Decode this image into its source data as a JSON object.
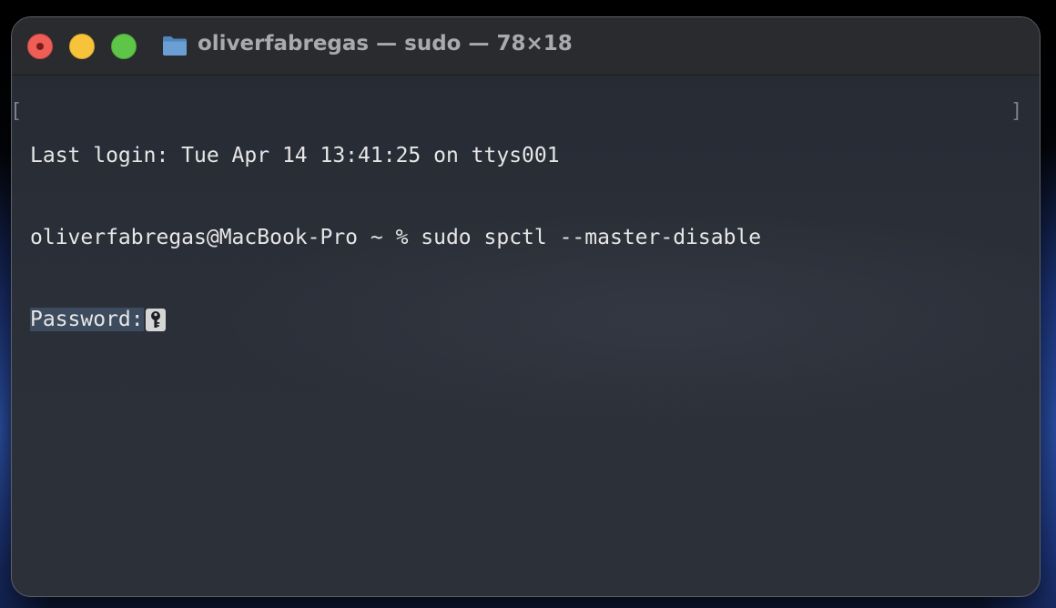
{
  "window": {
    "title": "oliverfabregas — sudo — 78×18"
  },
  "terminal": {
    "last_login": "Last login: Tue Apr 14 13:41:25 on ttys001",
    "command_line": "oliverfabregas@MacBook-Pro ~ % sudo spctl --master-disable",
    "password_prompt": "Password:",
    "mark_left": "[",
    "mark_right": "]"
  },
  "icons": {
    "folder": "folder-icon",
    "cursor": "key-icon"
  },
  "colors": {
    "close": "#ee5e57",
    "minimize": "#f6c33a",
    "maximize": "#5fc548",
    "folder": "#5b8ec3",
    "terminal_text": "#e6e6e6",
    "prompt_highlight": "#3d4b5e"
  }
}
